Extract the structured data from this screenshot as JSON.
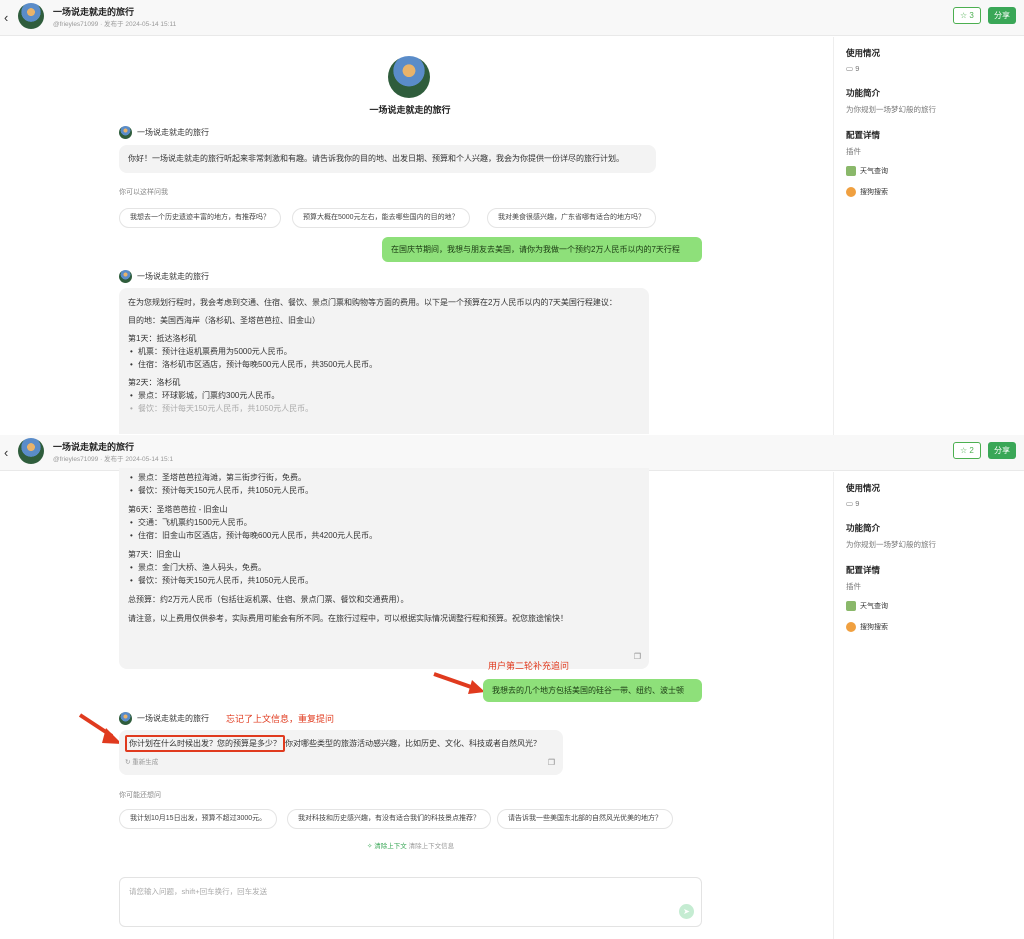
{
  "header": {
    "title": "一场说走就走的旅行",
    "author": "@frieyles71099",
    "pub_label": "发布于",
    "pub_date": "2024-05-14 15:11",
    "star_count": "3",
    "share": "分享"
  },
  "header2": {
    "title": "一场说走就走的旅行",
    "author": "@frieyles71099",
    "pub_label": "发布于",
    "pub_date": "2024-05-14 15:1",
    "star_count": "2",
    "share": "分享"
  },
  "sidebar": {
    "usage_title": "使用情况",
    "usage_count": "9",
    "intro_title": "功能简介",
    "intro_text": "为你规划一场梦幻般的旅行",
    "config_title": "配置详情",
    "plugins_label": "插件",
    "plugins": [
      "天气查询",
      "搜狗搜索"
    ]
  },
  "sidebar2": {
    "usage_title": "使用情况",
    "usage_count": "9",
    "intro_title": "功能简介",
    "intro_text": "为你规划一场梦幻般的旅行",
    "config_title": "配置详情",
    "plugins_label": "插件",
    "plugins": [
      "天气查询",
      "搜狗搜索"
    ]
  },
  "bot": {
    "name": "一场说走就走的旅行"
  },
  "greeting": "你好！一场说走就走的旅行听起来非常刺激和有趣。请告诉我你的目的地、出发日期、预算和个人兴趣，我会为你提供一份详尽的旅行计划。",
  "suggest_label": "你可以这样问我",
  "suggestions1": [
    "我想去一个历史遗迹丰富的地方，有推荐吗？",
    "预算大概在5000元左右，能去哪些国内的目的地？",
    "我对美食很感兴趣，广东省哪有适合的地方吗？"
  ],
  "user1": "在国庆节期间，我想与朋友去美国，请你为我做一个预约2万人民币以内的7天行程",
  "plan": {
    "intro": "在为您规划行程时，我会考虑到交通、住宿、餐饮、景点门票和购物等方面的费用。以下是一个预算在2万人民币以内的7天美国行程建议：",
    "dest": "目的地：美国西海岸（洛杉矶、圣塔芭芭拉、旧金山）",
    "d1": "第1天：抵达洛杉矶",
    "d1a": "机票：预计往返机票费用为5000元人民币。",
    "d1b": "住宿：洛杉矶市区酒店，预计每晚500元人民币，共3500元人民币。",
    "d2": "第2天：洛杉矶",
    "d2a": "景点：环球影城，门票约300元人民币。",
    "d2b": "餐饮：预计每天150元人民币，共1050元人民币。"
  },
  "plan2": {
    "a": "景点：圣塔芭芭拉海滩，第三街步行街，免费。",
    "b": "餐饮：预计每天150元人民币，共1050元人民币。",
    "d6": "第6天：圣塔芭芭拉 - 旧金山",
    "d6a": "交通：飞机票约1500元人民币。",
    "d6b": "住宿：旧金山市区酒店，预计每晚600元人民币，共4200元人民币。",
    "d7": "第7天：旧金山",
    "d7a": "景点：金门大桥、渔人码头，免费。",
    "d7b": "餐饮：预计每天150元人民币，共1050元人民币。",
    "total": "总预算：约2万元人民币（包括往返机票、住宿、景点门票、餐饮和交通费用）。",
    "note": "请注意，以上费用仅供参考，实际费用可能会有所不同。在旅行过程中，可以根据实际情况调整行程和预算。祝您旅途愉快！"
  },
  "anno1": "用户第二轮补充追问",
  "user2": "我想去的几个地方包括美国的硅谷一带、纽约、波士顿",
  "anno2": "忘记了上文信息，重复提问",
  "reply_highlight": "你计划在什么时候出发？您的预算是多少？",
  "reply_rest": "你对哪些类型的旅游活动感兴趣，比如历史、文化、科技或者自然风光？",
  "regen": "重新生成",
  "suggest2_label": "你可能还想问",
  "suggestions2": [
    "我计划10月15日出发，预算不超过3000元。",
    "我对科技和历史感兴趣，有没有适合我们的科技景点推荐？",
    "请告诉我一些美国东北部的自然风光优美的地方？"
  ],
  "clear": "清除上下文",
  "clear_hint": "清除上下文信息",
  "input_placeholder": "请您输入问题，shift+回车换行，回车发送"
}
